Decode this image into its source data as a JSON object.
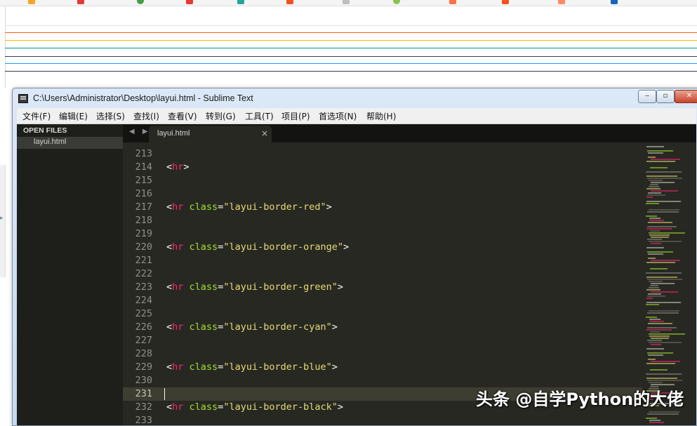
{
  "preview": {
    "hr_colors": [
      "#e2e2e2",
      "#ff5722",
      "#ffb800",
      "#009688",
      "#2f4056",
      "#1e9fff",
      "#393d49"
    ]
  },
  "window": {
    "title": "C:\\Users\\Administrator\\Desktop\\layui.html - Sublime Text",
    "controls": {
      "minimize": "‒",
      "maximize": "▫",
      "close": "✕"
    }
  },
  "menu": [
    "文件(F)",
    "编辑(E)",
    "选择(S)",
    "查找(I)",
    "查看(V)",
    "转到(G)",
    "工具(T)",
    "项目(P)",
    "首选项(N)",
    "帮助(H)"
  ],
  "sidebar": {
    "header": "OPEN FILES",
    "files": [
      "layui.html"
    ]
  },
  "tabs": {
    "nav": "◀ ▶",
    "active": {
      "label": "layui.html",
      "close": "×"
    }
  },
  "editor": {
    "current_line": 231,
    "lines": [
      {
        "n": "213",
        "open": "",
        "tag": "",
        "attr": "",
        "eq": "",
        "str": "",
        "close": ""
      },
      {
        "n": "214",
        "open": "<",
        "tag": "hr",
        "attr": "",
        "eq": "",
        "str": "",
        "close": ">"
      },
      {
        "n": "215",
        "open": "",
        "tag": "",
        "attr": "",
        "eq": "",
        "str": "",
        "close": ""
      },
      {
        "n": "216",
        "open": "",
        "tag": "",
        "attr": "",
        "eq": "",
        "str": "",
        "close": ""
      },
      {
        "n": "217",
        "open": "<",
        "tag": "hr",
        "attr": " class",
        "eq": "=",
        "str": "\"layui-border-red\"",
        "close": ">"
      },
      {
        "n": "218",
        "open": "",
        "tag": "",
        "attr": "",
        "eq": "",
        "str": "",
        "close": ""
      },
      {
        "n": "219",
        "open": "",
        "tag": "",
        "attr": "",
        "eq": "",
        "str": "",
        "close": ""
      },
      {
        "n": "220",
        "open": "<",
        "tag": "hr",
        "attr": " class",
        "eq": "=",
        "str": "\"layui-border-orange\"",
        "close": ">"
      },
      {
        "n": "221",
        "open": "",
        "tag": "",
        "attr": "",
        "eq": "",
        "str": "",
        "close": ""
      },
      {
        "n": "222",
        "open": "",
        "tag": "",
        "attr": "",
        "eq": "",
        "str": "",
        "close": ""
      },
      {
        "n": "223",
        "open": "<",
        "tag": "hr",
        "attr": " class",
        "eq": "=",
        "str": "\"layui-border-green\"",
        "close": ">"
      },
      {
        "n": "224",
        "open": "",
        "tag": "",
        "attr": "",
        "eq": "",
        "str": "",
        "close": ""
      },
      {
        "n": "225",
        "open": "",
        "tag": "",
        "attr": "",
        "eq": "",
        "str": "",
        "close": ""
      },
      {
        "n": "226",
        "open": "<",
        "tag": "hr",
        "attr": " class",
        "eq": "=",
        "str": "\"layui-border-cyan\"",
        "close": ">"
      },
      {
        "n": "227",
        "open": "",
        "tag": "",
        "attr": "",
        "eq": "",
        "str": "",
        "close": ""
      },
      {
        "n": "228",
        "open": "",
        "tag": "",
        "attr": "",
        "eq": "",
        "str": "",
        "close": ""
      },
      {
        "n": "229",
        "open": "<",
        "tag": "hr",
        "attr": " class",
        "eq": "=",
        "str": "\"layui-border-blue\"",
        "close": ">"
      },
      {
        "n": "230",
        "open": "",
        "tag": "",
        "attr": "",
        "eq": "",
        "str": "",
        "close": ""
      },
      {
        "n": "231",
        "open": "",
        "tag": "",
        "attr": "",
        "eq": "",
        "str": "",
        "close": ""
      },
      {
        "n": "232",
        "open": "<",
        "tag": "hr",
        "attr": " class",
        "eq": "=",
        "str": "\"layui-border-black\"",
        "close": ">"
      },
      {
        "n": "233",
        "open": "",
        "tag": "",
        "attr": "",
        "eq": "",
        "str": "",
        "close": ""
      }
    ]
  },
  "watermark": "头条 @自学Python的大佬",
  "colors": {
    "editor_bg": "#272822",
    "tag": "#f92672",
    "attr": "#a6e22e",
    "string": "#e6db74",
    "line_number": "#8f908a"
  }
}
